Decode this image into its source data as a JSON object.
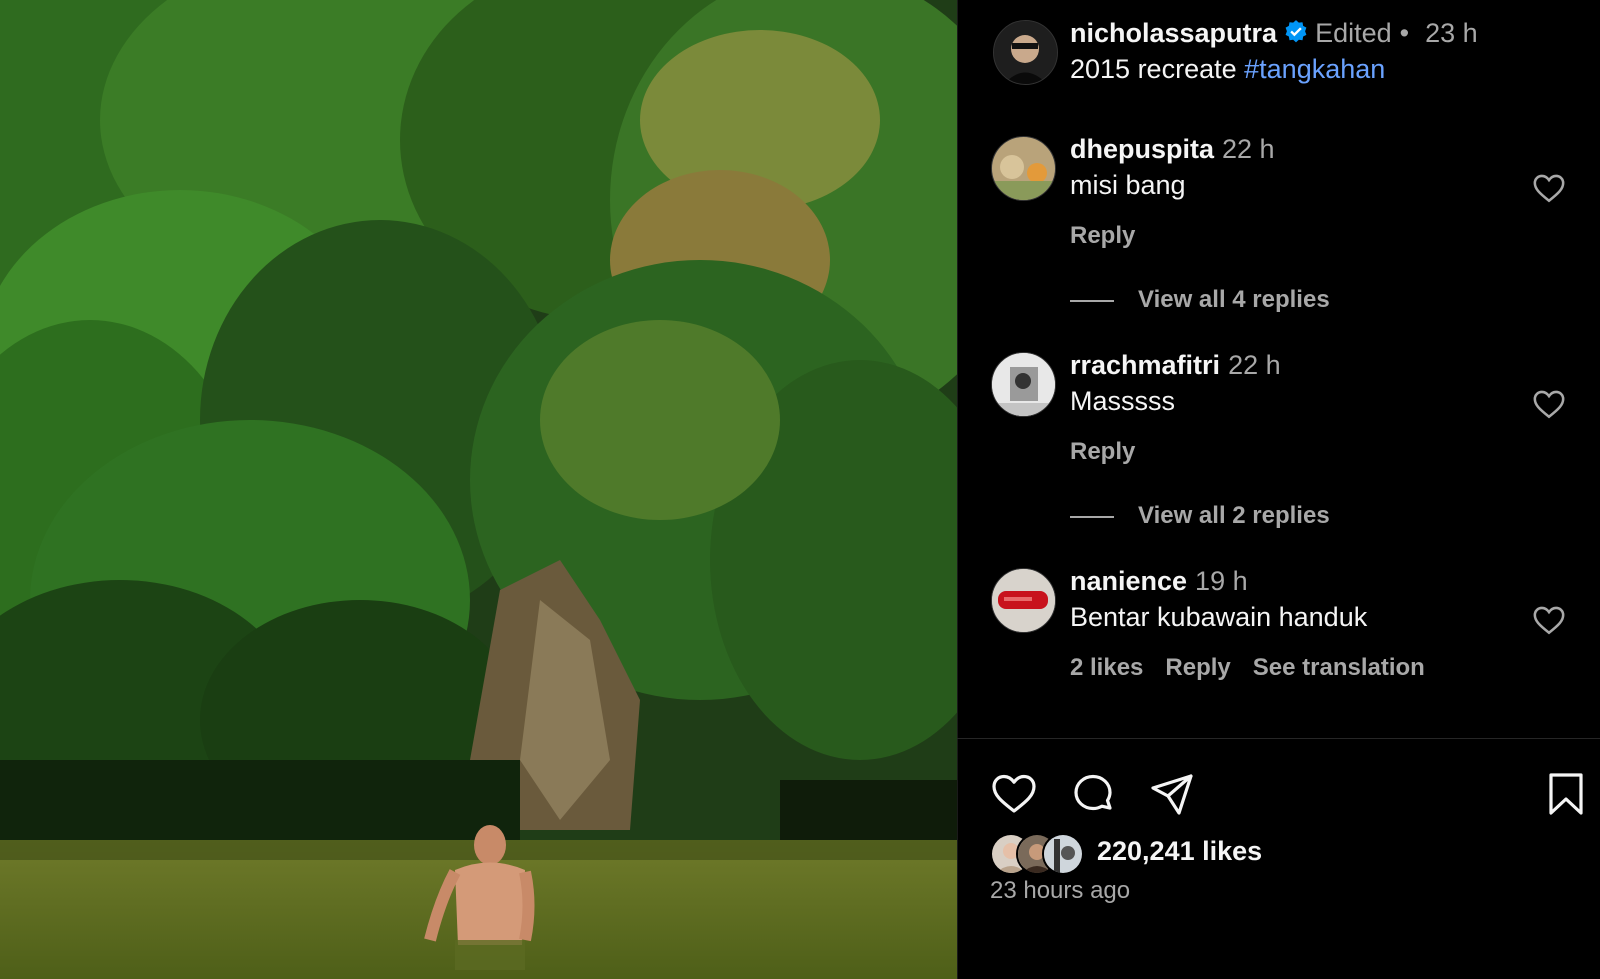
{
  "post": {
    "author": "nicholassaputra",
    "edited_label": "Edited",
    "separator": "•",
    "time": "23 h",
    "caption_text": "2015 recreate",
    "caption_hashtag": "#tangkahan"
  },
  "comments": [
    {
      "username": "dhepuspita",
      "time": "22 h",
      "text": "misi bang",
      "reply_label": "Reply",
      "view_replies": "View all 4 replies"
    },
    {
      "username": "rrachmafitri",
      "time": "22 h",
      "text": "Masssss",
      "reply_label": "Reply",
      "view_replies": "View all 2 replies"
    },
    {
      "username": "nanience",
      "time": "19 h",
      "text": "Bentar kubawain handuk",
      "likes_label": "2 likes",
      "reply_label": "Reply",
      "translation_label": "See translation"
    }
  ],
  "footer": {
    "likes": "220,241 likes",
    "posted_ago": "23 hours ago"
  },
  "colors": {
    "background": "#000000",
    "primary_text": "#f5f5f5",
    "secondary_text": "#a8a8a8",
    "hashtag": "#6aa2ff",
    "verified": "#0095f6"
  },
  "icons": [
    "verified-badge-icon",
    "heart-icon",
    "comment-icon",
    "share-icon",
    "bookmark-icon"
  ]
}
